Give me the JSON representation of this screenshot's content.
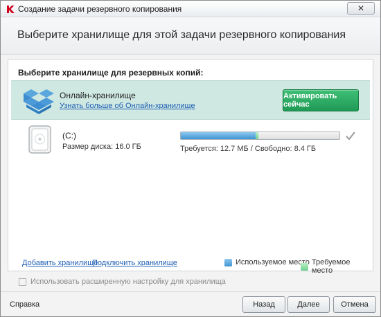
{
  "window": {
    "title": "Создание задачи резервного копирования",
    "close_label": "✕"
  },
  "header": {
    "title": "Выберите хранилище для этой задачи резервного копирования"
  },
  "storage": {
    "section_label": "Выберите хранилище для резервных копий:",
    "online": {
      "title": "Онлайн-хранилище",
      "link": "Узнать больше об Онлайн-хранилище",
      "activate_button": "Активировать сейчас",
      "icon": "cloud-box-icon"
    },
    "disk": {
      "name": "(C:)",
      "size_label": "Размер диска:",
      "size_value": "16.0 ГБ",
      "usage_text": "Требуется: 12.7 МБ / Свободно: 8.4 ГБ",
      "used_fraction": 0.47,
      "required_fraction": 0.02,
      "icon": "hard-drive-icon",
      "status_icon": "check-icon"
    },
    "add_link": "Добавить хранилище",
    "connect_link": "Подключить хранилище",
    "legend": {
      "used": "Используемое место",
      "required": "Требуемое место"
    }
  },
  "advanced": {
    "label": "Использовать расширенную настройку для хранилища",
    "checked": false
  },
  "footer": {
    "help": "Справка",
    "back": "Назад",
    "next": "Далее",
    "cancel": "Отмена"
  },
  "colors": {
    "used": "#3e95d3",
    "required": "#6fd08e",
    "accent_green": "#1f9a55",
    "online_bg": "#cfe8e2",
    "link": "#1f5fb4"
  }
}
